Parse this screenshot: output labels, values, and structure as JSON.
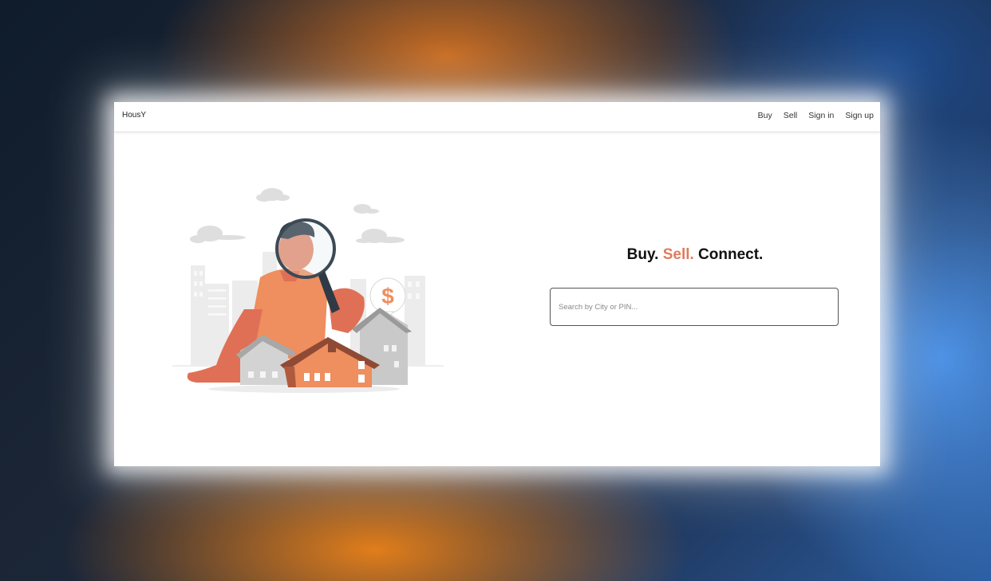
{
  "navbar": {
    "brand": "HousY",
    "links": [
      "Buy",
      "Sell",
      "Sign in",
      "Sign up"
    ]
  },
  "hero": {
    "headline_part1": "Buy. ",
    "headline_part2": "Sell.",
    "headline_part3": " Connect.",
    "search_placeholder": "Search by City or PIN...",
    "search_value": "",
    "illustration_symbol": "$"
  },
  "colors": {
    "accent": "#e17a5f",
    "illustration_orange": "#ef8e5e",
    "illustration_brown": "#8f4a35",
    "illustration_gray": "#b8b8b8"
  },
  "icons": [
    "magnifying-glass-icon",
    "dollar-bubble-icon"
  ]
}
